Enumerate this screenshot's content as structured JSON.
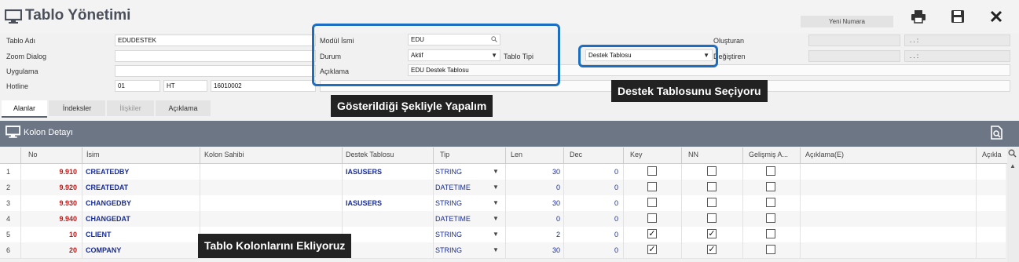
{
  "header": {
    "title": "Tablo Yönetimi",
    "new_number": "Yeni Numara",
    "actions": {
      "print": "print-icon",
      "save": "save-icon",
      "close": "close-icon"
    }
  },
  "form": {
    "table_name": {
      "label": "Tablo Adı",
      "value": "EDUDESTEK"
    },
    "zoom_dialog": {
      "label": "Zoom Dialog",
      "value": ""
    },
    "application": {
      "label": "Uygulama",
      "value": ""
    },
    "hotline": {
      "label": "Hotline",
      "v1": "01",
      "v2": "HT",
      "v3": "16010002"
    },
    "module_name": {
      "label": "Modül İsmi",
      "value": "EDU"
    },
    "status": {
      "label": "Durum",
      "value": "Aktif"
    },
    "table_type": {
      "label": "Tablo Tipi",
      "value": "Destek Tablosu"
    },
    "description": {
      "label": "Açıklama",
      "value": "EDU Destek Tablosu"
    },
    "created": {
      "label": "Oluşturan",
      "date": ". .   :"
    },
    "changed": {
      "label": "Değiştiren",
      "date": ". .   :"
    }
  },
  "annotations": {
    "shown": "Gösterildiği Şekliyle Yapalım",
    "selecting": "Destek Tablosunu Seçiyoru",
    "adding": "Tablo Kolonlarını Ekliyoruz"
  },
  "tabs": [
    {
      "label": "Alanlar",
      "state": "active"
    },
    {
      "label": "İndeksler",
      "state": "normal"
    },
    {
      "label": "İlişkiler",
      "state": "disabled"
    },
    {
      "label": "Açıklama",
      "state": "normal"
    }
  ],
  "section": {
    "title": "Kolon Detayı"
  },
  "columns": [
    "No",
    "İsim",
    "Kolon Sahibi",
    "Destek Tablosu",
    "Tip",
    "Len",
    "Dec",
    "Key",
    "NN",
    "Gelişmiş A...",
    "Açıklama(E)",
    "Açıkla"
  ],
  "rows": [
    {
      "idx": "1",
      "no": "9.910",
      "name": "CREATEDBY",
      "owner": "",
      "support": "IASUSERS",
      "type": "STRING",
      "len": "30",
      "dec": "0",
      "key": false,
      "nn": false,
      "adv": false
    },
    {
      "idx": "2",
      "no": "9.920",
      "name": "CREATEDAT",
      "owner": "",
      "support": "",
      "type": "DATETIME",
      "len": "0",
      "dec": "0",
      "key": false,
      "nn": false,
      "adv": false
    },
    {
      "idx": "3",
      "no": "9.930",
      "name": "CHANGEDBY",
      "owner": "",
      "support": "IASUSERS",
      "type": "STRING",
      "len": "30",
      "dec": "0",
      "key": false,
      "nn": false,
      "adv": false
    },
    {
      "idx": "4",
      "no": "9.940",
      "name": "CHANGEDAT",
      "owner": "",
      "support": "",
      "type": "DATETIME",
      "len": "0",
      "dec": "0",
      "key": false,
      "nn": false,
      "adv": false
    },
    {
      "idx": "5",
      "no": "10",
      "name": "CLIENT",
      "owner": "",
      "support": "",
      "type": "STRING",
      "len": "2",
      "dec": "0",
      "key": true,
      "nn": true,
      "adv": false
    },
    {
      "idx": "6",
      "no": "20",
      "name": "COMPANY",
      "owner": "",
      "support": "",
      "type": "STRING",
      "len": "30",
      "dec": "0",
      "key": true,
      "nn": true,
      "adv": false
    }
  ],
  "colors": {
    "accent": "#1b6ec2",
    "section_bar": "#6c7685",
    "number_red": "#b21e1e",
    "name_blue": "#1a2d8f"
  }
}
